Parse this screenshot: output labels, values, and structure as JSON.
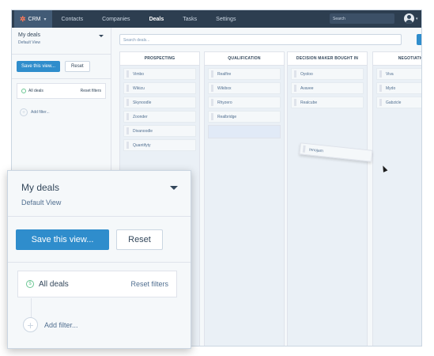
{
  "topbar": {
    "brand_label": "CRM",
    "nav": [
      "Contacts",
      "Companies",
      "Deals",
      "Tasks",
      "Settings"
    ],
    "active_nav": "Deals",
    "search_placeholder": "Search"
  },
  "sidebar": {
    "title": "My deals",
    "subtitle": "Default View",
    "save_label": "Save this view...",
    "reset_label": "Reset",
    "filter_label": "All deals",
    "reset_filters_label": "Reset filters",
    "add_filter_label": "Add filter..."
  },
  "board": {
    "search_placeholder": "Search deals...",
    "columns": [
      {
        "title": "PROSPECTING",
        "cards": [
          "Vimbo",
          "Wikizu",
          "Skynoodle",
          "Zoonder",
          "Divanoodle",
          "Quantifyty"
        ]
      },
      {
        "title": "QUALIFICATION",
        "cards": [
          "Realfire",
          "Wikibox",
          "Rhyzero",
          "Realbridge"
        ]
      },
      {
        "title": "DECISION MAKER BOUGHT IN",
        "cards": [
          "Oyoloo",
          "Avavee",
          "Realcube"
        ]
      },
      {
        "title": "NEGOTIATION",
        "cards": [
          "Viva",
          "Mydo",
          "Gabzicle"
        ]
      }
    ],
    "dragging_card": "Innojam"
  },
  "zoom": {
    "title": "My deals",
    "subtitle": "Default View",
    "save_label": "Save this view...",
    "reset_label": "Reset",
    "filter_label": "All deals",
    "reset_filters_label": "Reset filters",
    "add_filter_label": "Add filter..."
  },
  "colors": {
    "topbar_bg": "#2d3e50",
    "accent_blue": "#2f8dcc",
    "brand_orange": "#ff7a59",
    "filter_green": "#6cc794"
  }
}
